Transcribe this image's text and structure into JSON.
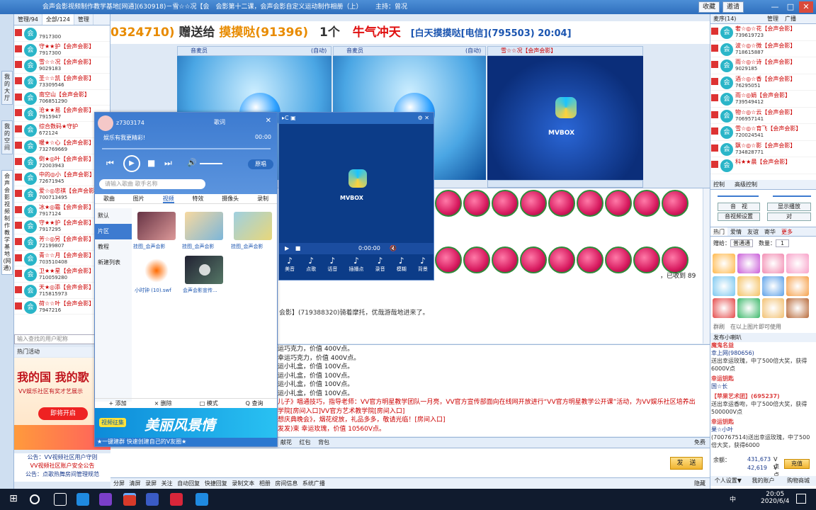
{
  "window": {
    "title": "会声会影视频制作教学基地[网通](630918)－雪☆☆况【会　会影第十二课，会声会影自定义运动制作相册（上）",
    "host": "主持：曾况",
    "buttons": [
      "收藏",
      "邀请"
    ]
  },
  "left_tabs": [
    "我的大厅",
    "我的空间",
    "会声会影视频制作教学基地(网通)"
  ],
  "left_panel": {
    "tabs": [
      "管理/94",
      "全部/124",
      "管理"
    ],
    "users": [
      {
        "name": "",
        "id": "7917300"
      },
      {
        "name": "守★★护【会声会影】",
        "id": "7917300"
      },
      {
        "name": "雪☆☆况【会声会影】",
        "id": "9029183"
      },
      {
        "name": "圣☆☆凯【会声会影】",
        "id": "73309546"
      },
      {
        "name": "南空山【会声会影】",
        "id": "706851290"
      },
      {
        "name": "沧★★易【会声会影】",
        "id": "7915947"
      },
      {
        "name": "综合数码★守护",
        "id": "672124"
      },
      {
        "name": "暖★☆心【会声会影】",
        "id": "732769669"
      },
      {
        "name": "倒★◎叶【会声会影】",
        "id": "72003943"
      },
      {
        "name": "中的◎小【会声会影】",
        "id": "72671945"
      },
      {
        "name": "爱☆◎忠祺【会声会影】",
        "id": "700713495"
      },
      {
        "name": "冰★◎霜【会声会影】",
        "id": "7917124"
      },
      {
        "name": "守★★护【会声会影】",
        "id": "7917295"
      },
      {
        "name": "芳☆◎另【会声会影】",
        "id": "72199807"
      },
      {
        "name": "青☆☆月【会声会影】",
        "id": "703510408"
      },
      {
        "name": "卫★★星【会声会影】",
        "id": "710059280"
      },
      {
        "name": "天★◎添【会声会影】",
        "id": "715815973"
      },
      {
        "name": "荷☆☆叶【会声会影】",
        "id": "7947216"
      }
    ],
    "search_placeholder": "输入查找的用户昵称",
    "hot": "热门活动",
    "banner": {
      "title": "我的国 我的歌",
      "sub": "VV娱乐社区有奖才艺展示",
      "btn": "即将开启"
    },
    "notices": [
      "公告：VV视频社区用户守则",
      "VV视频社区账户安全公告",
      "公告：点歌热舞房间管理规范"
    ]
  },
  "ticker": {
    "a": "0324710)",
    "b": "赠送给",
    "c": "摸摸哒(91396)",
    "d": "1个",
    "e": "牛气冲天",
    "f": "[白天摸摸哒[电信](795503) 20:04]"
  },
  "video": {
    "mics": [
      "音麦员",
      "(自动)",
      "音麦员",
      "(自动)",
      "雪☆☆况【会声会影】"
    ],
    "brand": "MVBOX"
  },
  "chat": {
    "received": "，已收到 89",
    "enter": "会影】(719388320)骑着摩托，优哉游哉地进来了。"
  },
  "chat2": [
    "运巧克力，价值 400V点。",
    "幸运巧克力，价值 400V点。",
    "运小礼盒，价值 100V点。",
    "运小礼盒，价值 100V点。",
    "运小礼盒，价值 100V点。",
    "运小礼盒，价值 100V点。",
    "儿子》唱通技巧，指导老师：VV官方明星教学团队一月亮，VV官方宣传部面向在线网开放进行“VV官方明星教学公开课”活动，为VV娱乐社区培养出",
    "学院[房间入口]VV官方艺术教学院[房间入口]",
    "想庆典晚会》，烟花绽放，礼品多多，敬请光临！[房间入口]",
    "发发)束 幸运玫瑰，价值 10560V点。"
  ],
  "toolbar2": [
    "献花",
    "红包",
    "背包",
    "免费"
  ],
  "send": "发　送",
  "bottombar": [
    "分屏",
    "清屏",
    "录屏",
    "关注",
    "自动回复",
    "快捷回复",
    "录制文本",
    "相册",
    "房间信息",
    "系统广播"
  ],
  "bottom_right": "隐藏",
  "right_panel": {
    "tabs": [
      "麦序(14)",
      "管理",
      "广播"
    ],
    "users": [
      {
        "name": "奢☆◎☆花【会声会影】",
        "id": "739619723"
      },
      {
        "name": "波☆◎☆微【会声会影】",
        "id": "718615887"
      },
      {
        "name": "雨☆◎☆诗【会声会影】",
        "id": "9029185"
      },
      {
        "name": "酒☆◎☆香【会声会影】",
        "id": "76295051"
      },
      {
        "name": "雨☆◎娟【会声会影】",
        "id": "739549412"
      },
      {
        "name": "物☆◎☆云【会声会影】",
        "id": "706957141"
      },
      {
        "name": "雪☆◎☆育飞【会声会影】",
        "id": "720024541"
      },
      {
        "name": "飘☆◎☆影【会声会影】",
        "id": "734828771"
      },
      {
        "name": "科★★晨【会声会影】",
        "id": ""
      }
    ],
    "control_tabs": [
      "控制",
      "高级控制"
    ],
    "ctrl_btns": [
      "音　视",
      "显示播放",
      "音视频设置",
      "对"
    ],
    "gift_tabs": [
      "热门",
      "爱情",
      "友谊",
      "寄华",
      "更多"
    ],
    "send_to": "赠给：",
    "send_to_value": "普通通",
    "qty_label": "数量：",
    "qty": "1",
    "gift_hint": "群刷　在以上图片即可使用",
    "publish": "发布小喇叭",
    "feed": [
      {
        "a": "魔鬼名益",
        "b": "幸上网(980656)",
        "c": "送出幸运玫瑰，中了500倍大奖，获得6000V点"
      },
      {
        "a": "幸运钥匙",
        "b": "国☆长",
        "c": ""
      },
      {
        "a": "【苹果艺术团】(695237)",
        "b": "",
        "c": "送出幸运香吻，中了500倍大奖，获得500000V点"
      },
      {
        "a": "幸运钥匙",
        "b": "果☆小叶",
        "c": "(700767514)送出幸运玫瑰，中了500倍大奖，获得6000"
      }
    ],
    "balance_label": "余额：",
    "balance1": "431,673",
    "balance2": "42,619",
    "unit": "V点",
    "recharge": "充值",
    "bottom_btns": [
      "个人设置▼",
      "我的账户",
      "购物商城"
    ]
  },
  "music": {
    "user": "z7303174",
    "title": "娱乐有我更精彩!",
    "time": "00:00",
    "search_placeholder": "请输入歌曲 歌手名称",
    "mode": "原唱",
    "mode_left": "歌词",
    "tabs": [
      "歌曲",
      "图片",
      "视频",
      "特效",
      "摄像头",
      "录制"
    ],
    "active_tab": "视频",
    "side": [
      "默认",
      "片区",
      "教程",
      "新建列表"
    ],
    "items": [
      {
        "caption": "挂图_会声会影"
      },
      {
        "caption": "挂图_会声会影"
      },
      {
        "caption": "挂图_会声会影"
      },
      {
        "caption": "小时钟 (10).swf"
      },
      {
        "caption": "会声会影宣传..."
      }
    ],
    "foot": [
      "+ 添加",
      "× 删除",
      "□ 模式",
      "Q 查询"
    ],
    "banner": {
      "a": "视频征集",
      "b": "美丽风景情"
    },
    "msg": "★一键建群 快速创建自己的V友圈★"
  },
  "player": {
    "brand": "MVBOX",
    "time": "0:00:00",
    "tools": [
      "美音",
      "点歌",
      "话音",
      "插播点",
      "录音",
      "模糊",
      "背景"
    ]
  },
  "taskbar": {
    "time": "20:05",
    "date": "2020/6/4",
    "ime": "中"
  }
}
